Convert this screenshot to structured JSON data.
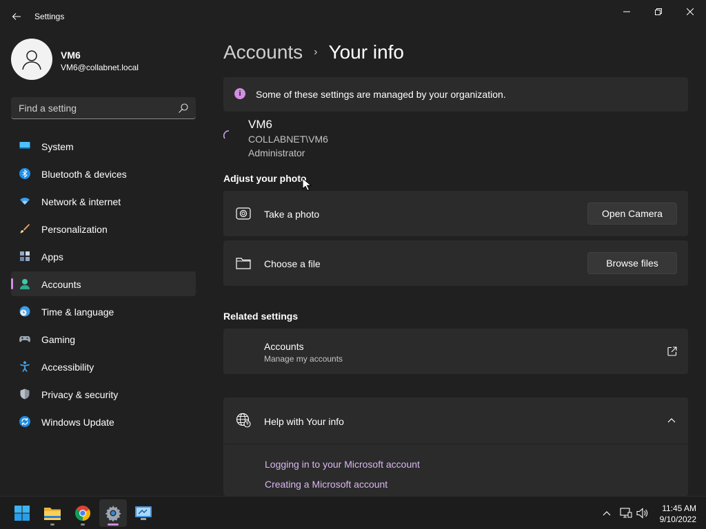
{
  "window": {
    "title": "Settings",
    "controls": {
      "minimize": "minimize-icon",
      "maximize": "restore-icon",
      "close": "close-icon"
    }
  },
  "profile": {
    "name": "VM6",
    "email": "VM6@collabnet.local"
  },
  "search": {
    "placeholder": "Find a setting",
    "value": ""
  },
  "sidebar": {
    "items": [
      {
        "label": "System",
        "icon": "system-icon",
        "selected": false
      },
      {
        "label": "Bluetooth & devices",
        "icon": "bluetooth-icon",
        "selected": false
      },
      {
        "label": "Network & internet",
        "icon": "wifi-icon",
        "selected": false
      },
      {
        "label": "Personalization",
        "icon": "brush-icon",
        "selected": false
      },
      {
        "label": "Apps",
        "icon": "apps-icon",
        "selected": false
      },
      {
        "label": "Accounts",
        "icon": "person-icon",
        "selected": true
      },
      {
        "label": "Time & language",
        "icon": "clock-globe-icon",
        "selected": false
      },
      {
        "label": "Gaming",
        "icon": "gamepad-icon",
        "selected": false
      },
      {
        "label": "Accessibility",
        "icon": "accessibility-icon",
        "selected": false
      },
      {
        "label": "Privacy & security",
        "icon": "shield-icon",
        "selected": false
      },
      {
        "label": "Windows Update",
        "icon": "update-icon",
        "selected": false
      }
    ]
  },
  "breadcrumb": {
    "parent": "Accounts",
    "separator": "›",
    "current": "Your info"
  },
  "org_banner": {
    "text": "Some of these settings are managed by your organization.",
    "icon": "info-icon"
  },
  "user": {
    "display_name": "VM6",
    "domain_account": "COLLABNET\\VM6",
    "role": "Administrator"
  },
  "adjust_photo": {
    "title": "Adjust your photo",
    "take_photo_label": "Take a photo",
    "open_camera_label": "Open Camera",
    "choose_file_label": "Choose a file",
    "browse_files_label": "Browse files"
  },
  "related": {
    "title": "Related settings",
    "accounts_label": "Accounts",
    "accounts_sub": "Manage my accounts"
  },
  "help": {
    "title": "Help with Your info",
    "links": [
      "Logging in to your Microsoft account",
      "Creating a Microsoft account"
    ]
  },
  "taskbar": {
    "apps": [
      "start-icon",
      "file-explorer-icon",
      "chrome-icon",
      "settings-icon",
      "remote-desktop-icon"
    ],
    "time": "11:45 AM",
    "date": "9/10/2022"
  },
  "colors": {
    "accent": "#d18fe0",
    "background": "#202020",
    "card": "#2b2b2b"
  }
}
